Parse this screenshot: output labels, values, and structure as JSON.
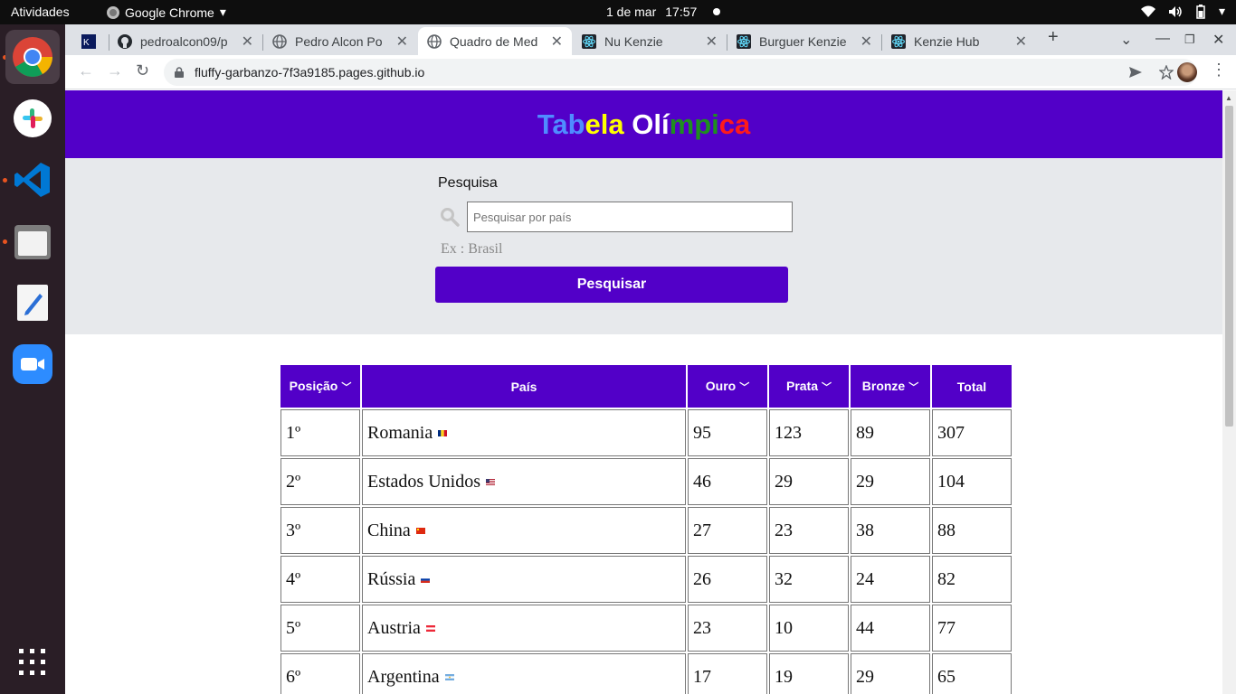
{
  "system": {
    "activities": "Atividades",
    "app_name": "Google Chrome",
    "date": "1 de mar",
    "time": "17:57"
  },
  "dock": {
    "items": [
      "chrome",
      "slack",
      "vscode",
      "files",
      "text-editor",
      "zoom",
      "app-grid"
    ]
  },
  "browser": {
    "tabs": [
      {
        "title": "",
        "icon": "kenzie-icon"
      },
      {
        "title": "pedroalcon09/p",
        "icon": "github-icon"
      },
      {
        "title": "Pedro Alcon Po",
        "icon": "globe-icon"
      },
      {
        "title": "Quadro de Med",
        "icon": "globe-icon",
        "active": true
      },
      {
        "title": "Nu Kenzie",
        "icon": "react-icon"
      },
      {
        "title": "Burguer Kenzie",
        "icon": "react-icon"
      },
      {
        "title": "Kenzie Hub",
        "icon": "react-icon"
      }
    ],
    "url": "fluffy-garbanzo-7f3a9185.pages.github.io"
  },
  "page": {
    "title_letters": [
      {
        "ch": "T",
        "color": "#4f8cff"
      },
      {
        "ch": "a",
        "color": "#4f8cff"
      },
      {
        "ch": "b",
        "color": "#4f8cff"
      },
      {
        "ch": "e",
        "color": "#ffff00"
      },
      {
        "ch": "l",
        "color": "#ffff00"
      },
      {
        "ch": "a",
        "color": "#ffff00"
      },
      {
        "ch": " ",
        "color": "#ffffff"
      },
      {
        "ch": "O",
        "color": "#ffffff"
      },
      {
        "ch": "l",
        "color": "#ffffff"
      },
      {
        "ch": "í",
        "color": "#ffffff"
      },
      {
        "ch": "m",
        "color": "#1f8f1f"
      },
      {
        "ch": "p",
        "color": "#1f8f1f"
      },
      {
        "ch": "i",
        "color": "#1f8f1f"
      },
      {
        "ch": "c",
        "color": "#ff1a1a"
      },
      {
        "ch": "a",
        "color": "#ff1a1a"
      }
    ],
    "search": {
      "label": "Pesquisa",
      "placeholder": "Pesquisar por país",
      "value": "",
      "hint": "Ex : Brasil",
      "button": "Pesquisar"
    },
    "table": {
      "headers": [
        "Posição",
        "País",
        "Ouro",
        "Prata",
        "Bronze",
        "Total"
      ],
      "sortable": [
        true,
        false,
        true,
        true,
        true,
        false
      ],
      "rows": [
        {
          "pos": "1º",
          "country": "Romania",
          "flag": "romania",
          "gold": "95",
          "silver": "123",
          "bronze": "89",
          "total": "307"
        },
        {
          "pos": "2º",
          "country": "Estados Unidos",
          "flag": "usa",
          "gold": "46",
          "silver": "29",
          "bronze": "29",
          "total": "104"
        },
        {
          "pos": "3º",
          "country": "China",
          "flag": "china",
          "gold": "27",
          "silver": "23",
          "bronze": "38",
          "total": "88"
        },
        {
          "pos": "4º",
          "country": "Rússia",
          "flag": "russia",
          "gold": "26",
          "silver": "32",
          "bronze": "24",
          "total": "82"
        },
        {
          "pos": "5º",
          "country": "Austria",
          "flag": "austria",
          "gold": "23",
          "silver": "10",
          "bronze": "44",
          "total": "77"
        },
        {
          "pos": "6º",
          "country": "Argentina",
          "flag": "argentina",
          "gold": "17",
          "silver": "19",
          "bronze": "29",
          "total": "65"
        }
      ]
    }
  },
  "colors": {
    "brand": "#5200c8",
    "search_bg": "#e7e9ec"
  }
}
